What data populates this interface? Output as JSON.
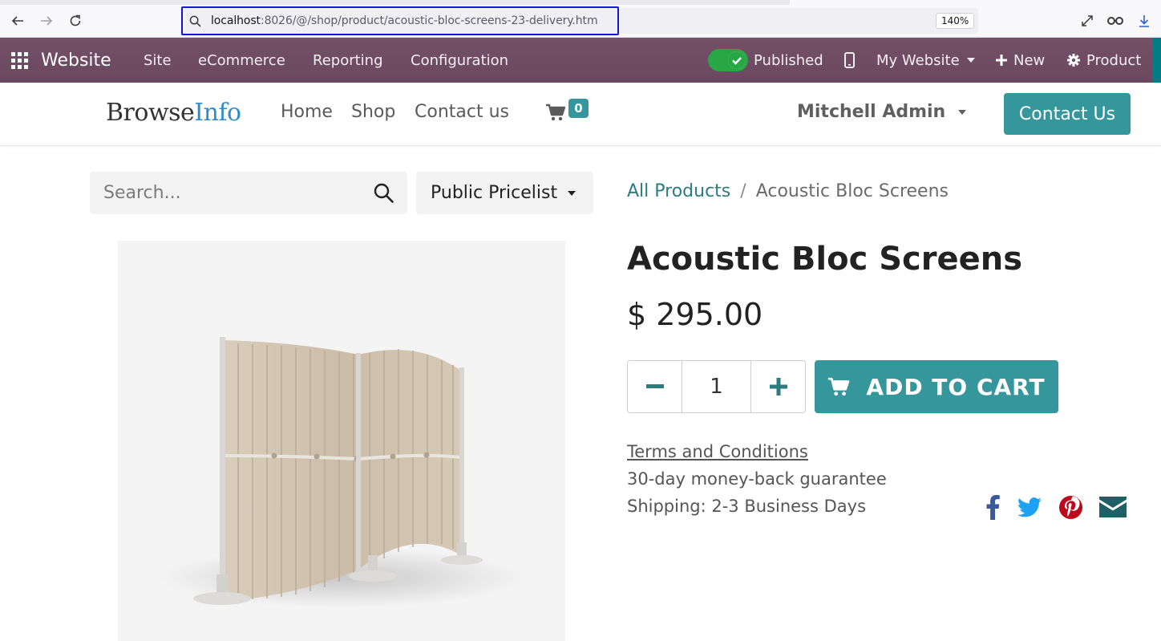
{
  "browser": {
    "url_host": "localhost",
    "url_rest": ":8026/@/shop/product/acoustic-bloc-screens-23-delivery.htm",
    "zoom": "140%"
  },
  "odoo_nav": {
    "app_name": "Website",
    "menu": [
      "Site",
      "eCommerce",
      "Reporting",
      "Configuration"
    ],
    "published_label": "Published",
    "published": true,
    "website_label": "My Website",
    "new_label": "New",
    "product_label": "Product",
    "color": "#714b67"
  },
  "site_header": {
    "logo_part1": "Browse",
    "logo_part2": "Info",
    "menu": [
      "Home",
      "Shop",
      "Contact us"
    ],
    "cart_count": "0",
    "user_name": "Mitchell Admin",
    "contact_button": "Contact Us",
    "accent_color": "#35979c"
  },
  "search": {
    "placeholder": "Search..."
  },
  "pricelist": {
    "selected": "Public Pricelist"
  },
  "breadcrumb": {
    "parent": "All Products",
    "current": "Acoustic Bloc Screens"
  },
  "product": {
    "name": "Acoustic Bloc Screens",
    "price": "$ 295.00",
    "quantity": "1",
    "add_to_cart": "ADD TO CART",
    "terms": "Terms and Conditions",
    "guarantee": "30-day money-back guarantee",
    "shipping": "Shipping: 2-3 Business Days"
  },
  "share": {
    "icons": [
      "facebook-icon",
      "twitter-icon",
      "pinterest-icon",
      "envelope-icon"
    ]
  }
}
